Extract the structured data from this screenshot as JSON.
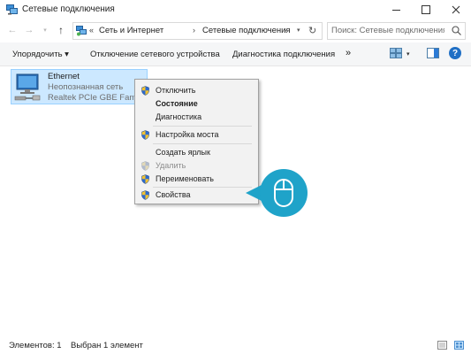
{
  "window": {
    "title": "Сетевые подключения",
    "title_icon": "network-connections-icon"
  },
  "navigation": {
    "back_icon": "arrow-left-icon",
    "forward_icon": "arrow-right-icon",
    "recent_icon": "chevron-down-icon",
    "up_icon": "arrow-up-icon",
    "back_glyph": "←",
    "forward_glyph": "→",
    "recent_glyph": "▾",
    "up_glyph": "↑"
  },
  "address": {
    "prefix": "«",
    "crumb1": "Сеть и Интернет",
    "separator": "›",
    "crumb2": "Сетевые подключения",
    "dropdown_glyph": "▾",
    "refresh_glyph": "↻"
  },
  "search": {
    "placeholder": "Поиск: Сетевые подключения",
    "icon": "search-icon"
  },
  "toolbar": {
    "organize": "Упорядочить ▾",
    "disable_device": "Отключение сетевого устройства",
    "diagnose": "Диагностика подключения",
    "more": "»",
    "view_dropdown": "▾",
    "help": "?"
  },
  "connection": {
    "name": "Ethernet",
    "status": "Неопознанная сеть",
    "adapter": "Realtek PCIe GBE Family ...",
    "icon": "ethernet-adapter-icon"
  },
  "context_menu": {
    "items": [
      {
        "label": "Отключить",
        "shield": true,
        "bold": false,
        "disabled": false
      },
      {
        "label": "Состояние",
        "shield": false,
        "bold": true,
        "disabled": false
      },
      {
        "label": "Диагностика",
        "shield": false,
        "bold": false,
        "disabled": false
      },
      {
        "label": "Настройка моста",
        "shield": true,
        "bold": false,
        "disabled": false
      },
      {
        "label": "Создать ярлык",
        "shield": false,
        "bold": false,
        "disabled": false
      },
      {
        "label": "Удалить",
        "shield": true,
        "bold": false,
        "disabled": true
      },
      {
        "label": "Переименовать",
        "shield": true,
        "bold": false,
        "disabled": false
      },
      {
        "label": "Свойства",
        "shield": true,
        "bold": false,
        "disabled": false
      }
    ]
  },
  "callout": {
    "icon": "mouse-click-icon",
    "color": "#1fa3c9"
  },
  "status_bar": {
    "count": "Элементов: 1",
    "selected": "Выбран 1 элемент"
  },
  "colors": {
    "selection_bg": "#cce8ff",
    "help_blue": "#1f6fc5",
    "accent_teal": "#1fa3c9"
  }
}
